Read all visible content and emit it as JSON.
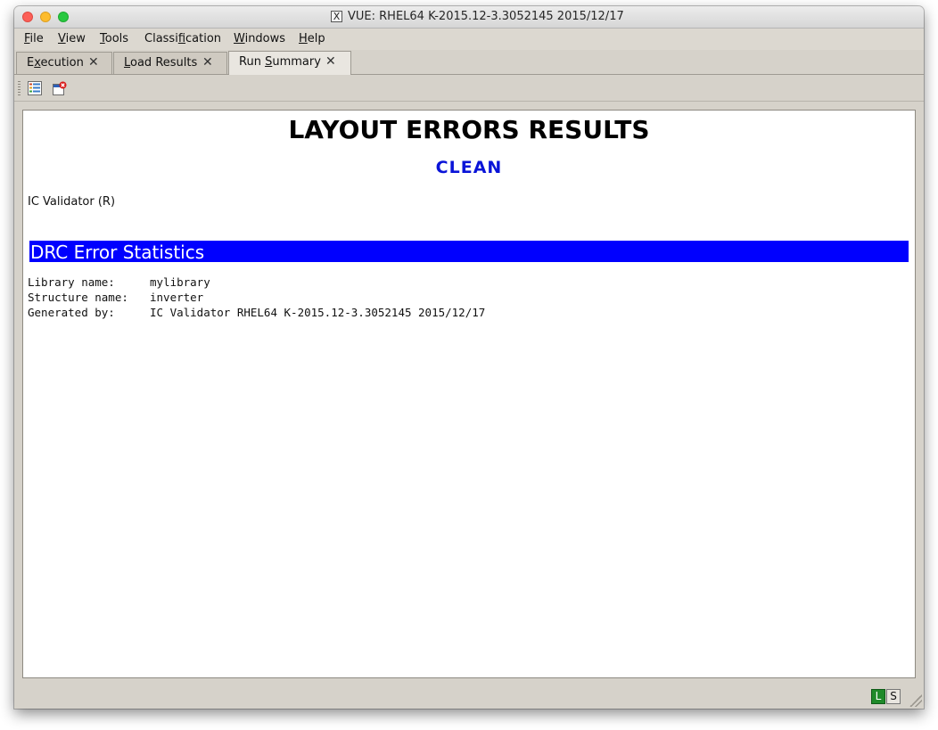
{
  "window": {
    "title": "VUE:  RHEL64 K-2015.12-3.3052145 2015/12/17",
    "x_icon": "X"
  },
  "menu": {
    "items": [
      {
        "pre": "",
        "mn": "F",
        "post": "ile"
      },
      {
        "pre": "",
        "mn": "V",
        "post": "iew"
      },
      {
        "pre": "",
        "mn": "T",
        "post": "ools"
      },
      {
        "pre": "Classi",
        "mn": "f",
        "post": "ication"
      },
      {
        "pre": "",
        "mn": "W",
        "post": "indows"
      },
      {
        "pre": "",
        "mn": "H",
        "post": "elp"
      }
    ]
  },
  "tabs": [
    {
      "pre": "E",
      "mn": "x",
      "post": "ecution",
      "close": "✕"
    },
    {
      "pre": "",
      "mn": "L",
      "post": "oad Results",
      "close": "✕"
    },
    {
      "pre": "Run ",
      "mn": "S",
      "post": "ummary",
      "close": "✕"
    }
  ],
  "toolbar": {
    "icons": [
      "list-view-icon",
      "close-report-icon"
    ]
  },
  "report": {
    "heading": "LAYOUT ERRORS RESULTS",
    "status": "CLEAN",
    "tool": "IC Validator (R)",
    "section_title": "DRC Error Statistics",
    "info": [
      {
        "key": "Library name:",
        "value": "mylibrary"
      },
      {
        "key": "Structure name:",
        "value": "inverter"
      },
      {
        "key": "Generated by:",
        "value": "IC Validator RHEL64 K-2015.12-3.3052145 2015/12/17"
      }
    ]
  },
  "statusbar": {
    "indicator_l": "L",
    "indicator_s": "S"
  },
  "colors": {
    "status_clean": "#0a14d8",
    "section_banner": "#0000ff",
    "indicator_l": "#1f8a2a"
  }
}
